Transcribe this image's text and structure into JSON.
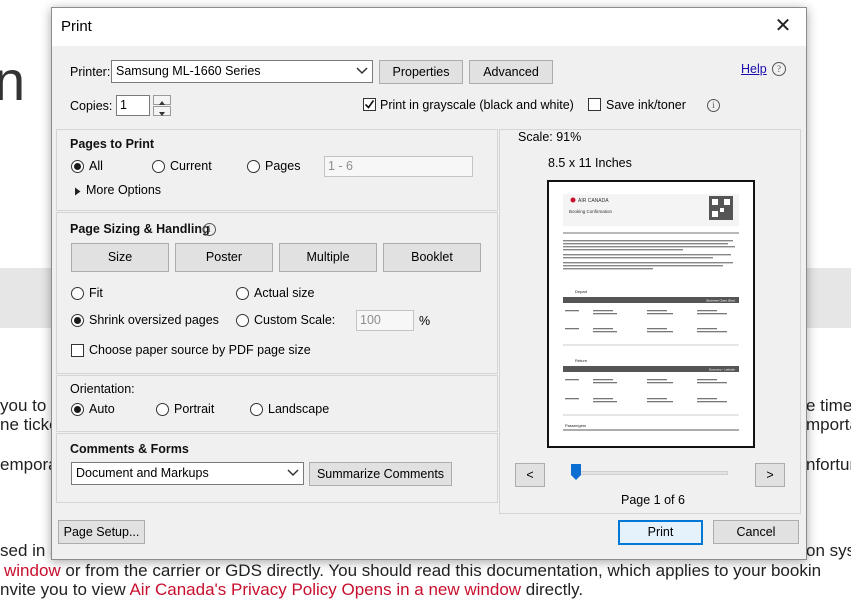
{
  "dialog": {
    "title": "Print",
    "help_label": "Help"
  },
  "printer": {
    "label": "Printer:",
    "selected": "Samsung ML-1660 Series",
    "properties_label": "Properties",
    "advanced_label": "Advanced"
  },
  "copies": {
    "label": "Copies:",
    "value": "1"
  },
  "options": {
    "grayscale_label": "Print in grayscale (black and white)",
    "grayscale_checked": true,
    "save_ink_label": "Save ink/toner",
    "save_ink_checked": false
  },
  "pages_to_print": {
    "heading": "Pages to Print",
    "all_label": "All",
    "current_label": "Current",
    "pages_label": "Pages",
    "pages_value": "1 - 6",
    "more_options_label": "More Options",
    "selected": "All"
  },
  "page_sizing": {
    "heading": "Page Sizing & Handling",
    "size_label": "Size",
    "poster_label": "Poster",
    "multiple_label": "Multiple",
    "booklet_label": "Booklet",
    "fit_label": "Fit",
    "actual_size_label": "Actual size",
    "shrink_label": "Shrink oversized pages",
    "custom_scale_label": "Custom Scale:",
    "custom_scale_value": "100",
    "percent": "%",
    "paper_source_label": "Choose paper source by PDF page size",
    "selected": "Shrink oversized pages"
  },
  "orientation": {
    "heading": "Orientation:",
    "auto_label": "Auto",
    "portrait_label": "Portrait",
    "landscape_label": "Landscape",
    "selected": "Auto"
  },
  "comments_forms": {
    "heading": "Comments & Forms",
    "selected": "Document and Markups",
    "summarize_label": "Summarize Comments"
  },
  "preview": {
    "scale_text": "Scale:  91%",
    "paper_size": "8.5 x 11 Inches",
    "prev_label": "<",
    "next_label": ">",
    "page_indicator": "Page 1 of 6",
    "page_fraction": 0.0,
    "doc_brand": "AIR CANADA",
    "doc_title": "Booking Confirmation",
    "doc_section_depart": "Depart",
    "doc_section_return": "Return",
    "doc_section_passengers": "Passengers",
    "doc_cabin_depart": "Business Class (Bus)",
    "doc_cabin_return": "Economy - Latitude"
  },
  "footer": {
    "page_setup_label": "Page Setup...",
    "print_label": "Print",
    "cancel_label": "Cancel"
  },
  "background": {
    "glyph": "n",
    "line1_left": "you to t",
    "line1_right": "e time",
    "line2_left": "ne ticke",
    "line2_right": "mporta",
    "line3_left": "empora",
    "line3_right": "nfortun",
    "line4_left": "sed in a",
    "line4_right": "on sys",
    "line5_red": "window",
    "line5_text": " or from the carrier or GDS directly. You should read this documentation, which applies to your bookin",
    "line6_text": "nvite you to view ",
    "line6_red": "Air Canada's Privacy Policy Opens in a new window",
    "line6_tail": " directly."
  }
}
